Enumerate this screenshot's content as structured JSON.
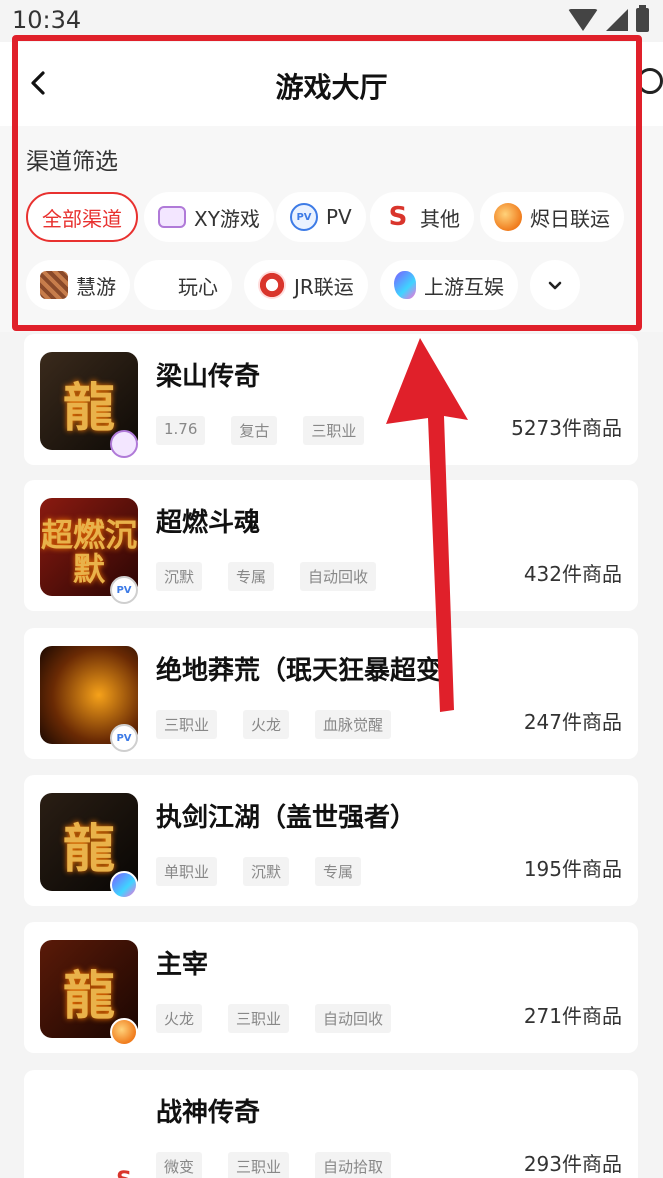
{
  "status": {
    "time": "10:34"
  },
  "header": {
    "title": "游戏大厅"
  },
  "filter": {
    "title": "渠道筛选",
    "channels": [
      {
        "label": "全部渠道"
      },
      {
        "label": "XY游戏"
      },
      {
        "label": "PV"
      },
      {
        "label": "其他"
      },
      {
        "label": "烬日联运"
      },
      {
        "label": "慧游"
      },
      {
        "label": "玩心"
      },
      {
        "label": "JR联运"
      },
      {
        "label": "上游互娱"
      }
    ]
  },
  "games": [
    {
      "name": "梁山传奇",
      "tags": [
        "1.76",
        "复古",
        "三职业"
      ],
      "count": "5273件商品",
      "icon_text": "龍"
    },
    {
      "name": "超燃斗魂",
      "tags": [
        "沉默",
        "专属",
        "自动回收"
      ],
      "count": "432件商品",
      "icon_text": "超燃沉默",
      "badge": "PV"
    },
    {
      "name": "绝地莽荒（珉天狂暴超变）",
      "tags": [
        "三职业",
        "火龙",
        "血脉觉醒"
      ],
      "count": "247件商品",
      "badge": "PV"
    },
    {
      "name": "执剑江湖（盖世强者）",
      "tags": [
        "单职业",
        "沉默",
        "专属"
      ],
      "count": "195件商品",
      "icon_text": "龍"
    },
    {
      "name": "主宰",
      "tags": [
        "火龙",
        "三职业",
        "自动回收"
      ],
      "count": "271件商品",
      "icon_text": "龍"
    },
    {
      "name": "战神传奇",
      "tags": [
        "微变",
        "三职业",
        "自动拾取"
      ],
      "count": "293件商品",
      "badge": "S"
    }
  ],
  "colors": {
    "accent": "#e8312f",
    "highlight": "#e0202a"
  }
}
